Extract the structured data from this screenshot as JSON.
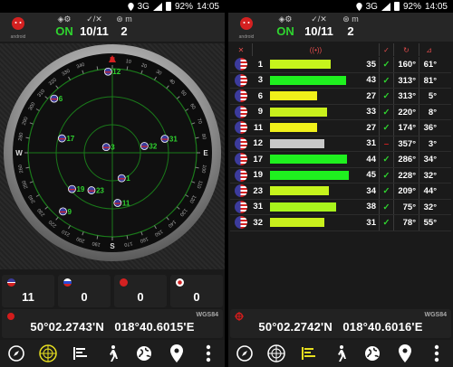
{
  "status": {
    "network": "3G",
    "battery": "92%",
    "time": "14:05"
  },
  "header": {
    "fix_status": "ON",
    "satellites": "10/11",
    "accuracy": "2",
    "accuracy_unit": "m"
  },
  "compass": {
    "ticks": [
      "330",
      "340",
      "10",
      "20",
      "30",
      "40",
      "50",
      "60",
      "70",
      "80",
      "100",
      "110",
      "120",
      "130",
      "140",
      "150",
      "160",
      "170",
      "190",
      "200",
      "210",
      "220",
      "230",
      "240",
      "250",
      "260",
      "280",
      "290",
      "300",
      "310",
      "320"
    ],
    "cardinals": [
      "N",
      "E",
      "S",
      "W"
    ],
    "satellites": [
      {
        "prn": "12",
        "az": 357,
        "el": 3
      },
      {
        "prn": "6",
        "az": 313,
        "el": 5
      },
      {
        "prn": "31",
        "az": 75,
        "el": 32
      },
      {
        "prn": "32",
        "az": 78,
        "el": 55
      },
      {
        "prn": "3",
        "az": 313,
        "el": 81
      },
      {
        "prn": "17",
        "az": 286,
        "el": 34
      },
      {
        "prn": "1",
        "az": 160,
        "el": 61
      },
      {
        "prn": "19",
        "az": 228,
        "el": 32
      },
      {
        "prn": "23",
        "az": 209,
        "el": 44
      },
      {
        "prn": "11",
        "az": 174,
        "el": 36
      },
      {
        "prn": "9",
        "az": 220,
        "el": 8
      }
    ]
  },
  "constellations": [
    {
      "name": "GPS",
      "count": "11"
    },
    {
      "name": "GLONASS",
      "count": "0"
    },
    {
      "name": "BeiDou",
      "count": "0"
    },
    {
      "name": "QZSS",
      "count": "0"
    }
  ],
  "location": {
    "datum": "WGS84",
    "left": "50°02.2743'N   018°40.6015'E",
    "right": "50°02.2742'N   018°40.6016'E"
  },
  "table": {
    "rows": [
      {
        "prn": "1",
        "snr": "35",
        "used": "✓",
        "az": "160°",
        "el": "61°",
        "color": "#c6f41c",
        "frac": 0.7
      },
      {
        "prn": "3",
        "snr": "43",
        "used": "✓",
        "az": "313°",
        "el": "81°",
        "color": "#1ff01f",
        "frac": 0.87
      },
      {
        "prn": "6",
        "snr": "27",
        "used": "✓",
        "az": "313°",
        "el": "5°",
        "color": "#f0f01a",
        "frac": 0.54
      },
      {
        "prn": "9",
        "snr": "33",
        "used": "✓",
        "az": "220°",
        "el": "8°",
        "color": "#c8f01c",
        "frac": 0.66
      },
      {
        "prn": "11",
        "snr": "27",
        "used": "✓",
        "az": "174°",
        "el": "36°",
        "color": "#f0f01a",
        "frac": 0.54
      },
      {
        "prn": "12",
        "snr": "31",
        "used": "–",
        "az": "357°",
        "el": "3°",
        "color": "#c8c8c8",
        "frac": 0.62
      },
      {
        "prn": "17",
        "snr": "44",
        "used": "✓",
        "az": "286°",
        "el": "34°",
        "color": "#1ff01f",
        "frac": 0.89
      },
      {
        "prn": "19",
        "snr": "45",
        "used": "✓",
        "az": "228°",
        "el": "32°",
        "color": "#1ff01f",
        "frac": 0.91
      },
      {
        "prn": "23",
        "snr": "34",
        "used": "✓",
        "az": "209°",
        "el": "44°",
        "color": "#c6f41c",
        "frac": 0.68
      },
      {
        "prn": "31",
        "snr": "38",
        "used": "✓",
        "az": "75°",
        "el": "32°",
        "color": "#a8f41c",
        "frac": 0.76
      },
      {
        "prn": "32",
        "snr": "31",
        "used": "✓",
        "az": "78°",
        "el": "55°",
        "color": "#c8f01c",
        "frac": 0.62
      }
    ]
  }
}
